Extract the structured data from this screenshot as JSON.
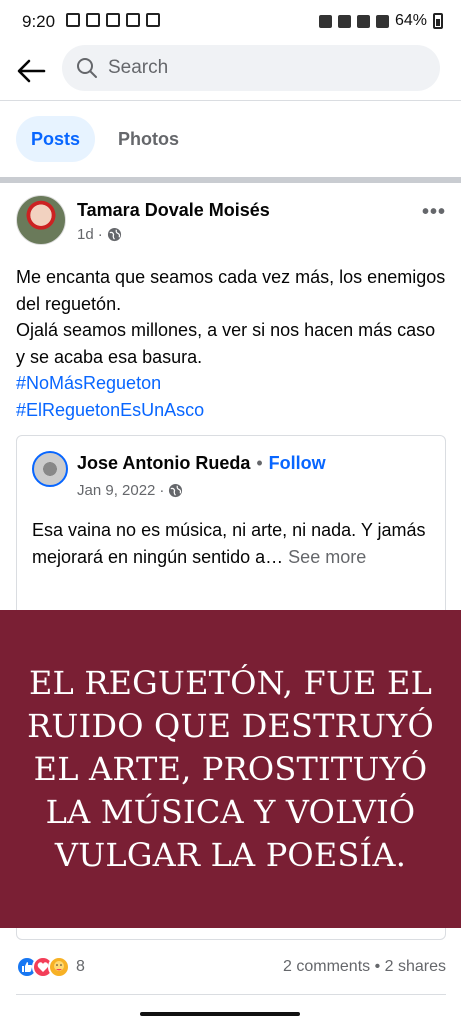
{
  "status_bar": {
    "time": "9:20",
    "battery": "64%"
  },
  "search": {
    "placeholder": "Search"
  },
  "tabs": [
    {
      "label": "Posts",
      "active": true
    },
    {
      "label": "Photos",
      "active": false
    }
  ],
  "post": {
    "author": "Tamara Dovale Moisés",
    "time": "1d",
    "text_lines": [
      "Me encanta que seamos cada vez más, los enemigos del reguetón.",
      "Ojalá seamos  millones, a ver si nos hacen más caso y se acaba esa basura."
    ],
    "hashtags": [
      "#NoMásRegueton",
      "#ElReguetonEsUnAsco"
    ],
    "shared": {
      "author": "Jose Antonio Rueda",
      "follow_label": "Follow",
      "date": "Jan 9, 2022",
      "text": "Esa vaina no es música, ni arte, ni nada. Y jamás mejorará en ningún sentido a…",
      "see_more": "See more",
      "image_text": "EL REGUETÓN, FUE EL RUIDO QUE DESTRUYÓ EL ARTE, PROSTITUYÓ LA MÚSICA Y VOLVIÓ VULGAR LA POESÍA."
    },
    "reaction_count": "8",
    "stats": "2 comments • 2 shares"
  },
  "colors": {
    "accent": "#0866ff",
    "image_bg": "#7a1f34"
  }
}
